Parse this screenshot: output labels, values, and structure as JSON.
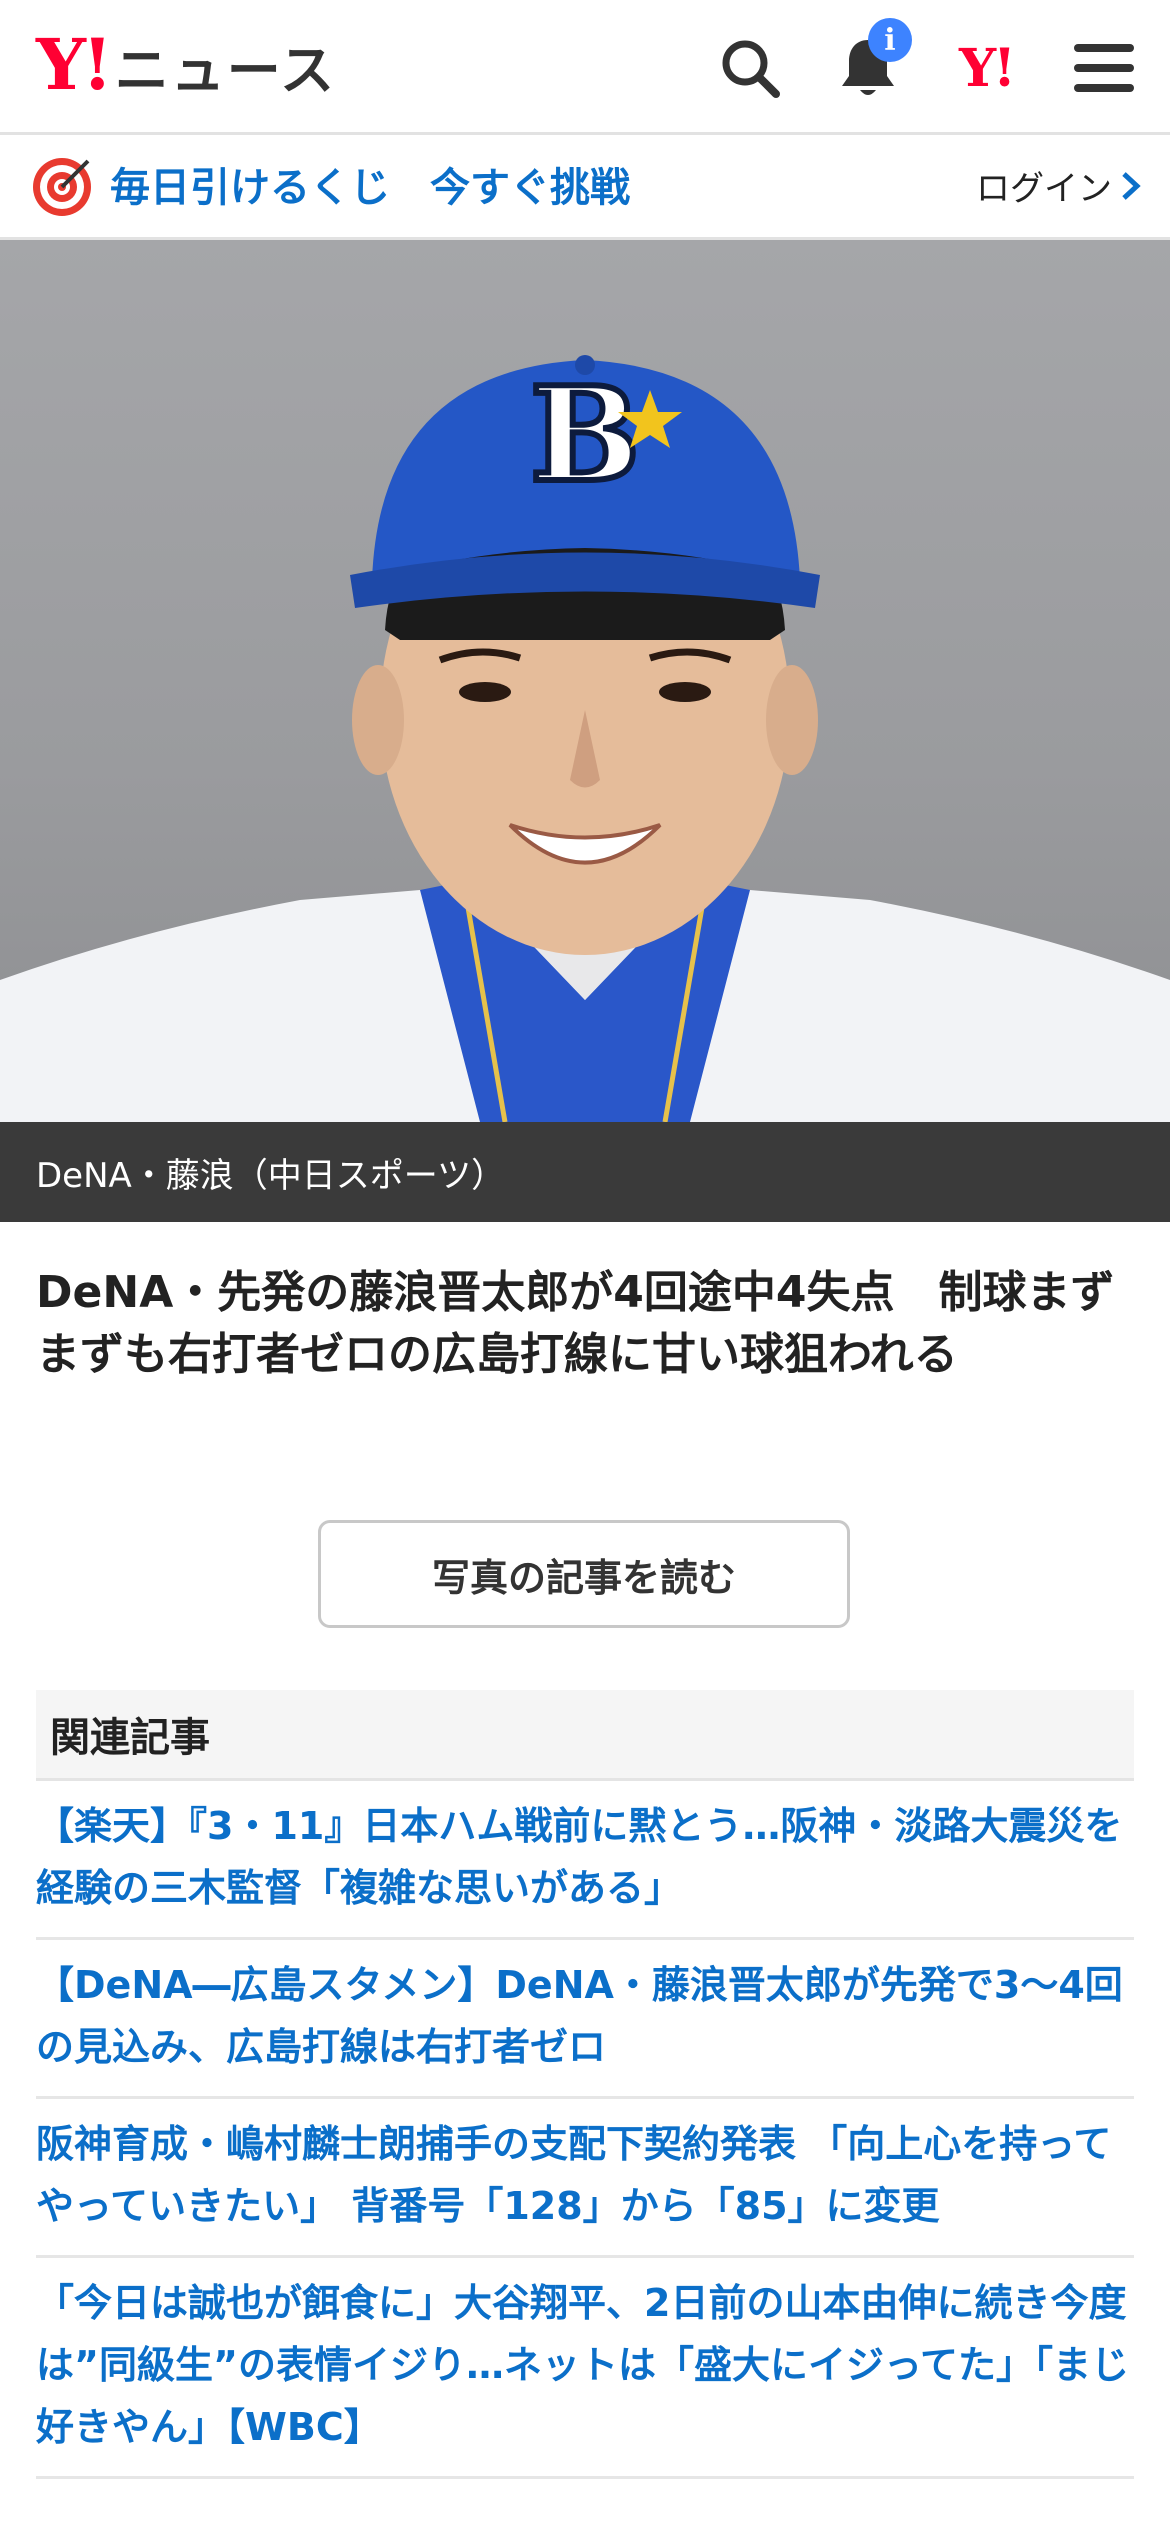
{
  "header": {
    "logo_y": "Y!",
    "logo_news": "ニュース",
    "notification_badge": "i",
    "yahoo_mark": "Y!"
  },
  "promo": {
    "text": "毎日引けるくじ　今すぐ挑戦",
    "login_label": "ログイン"
  },
  "photo": {
    "caption": "DeNA・藤浪（中日スポーツ）"
  },
  "article": {
    "title": "DeNA・先発の藤浪晋太郎が4回途中4失点　制球まずまずも右打者ゼロの広島打線に甘い球狙われる",
    "read_button": "写真の記事を読む"
  },
  "related": {
    "heading": "関連記事",
    "items": [
      "【楽天】『3・11』日本ハム戦前に黙とう…阪神・淡路大震災を経験の三木監督「複雑な思いがある」",
      "【DeNA―広島スタメン】DeNA・藤浪晋太郎が先発で3〜4回の見込み、広島打線は右打者ゼロ",
      "阪神育成・嶋村麟士朗捕手の支配下契約発表 「向上心を持ってやっていきたい」 背番号「128」から「85」に変更",
      "「今日は誠也が餌食に」大谷翔平、2日前の山本由伸に続き今度は”同級生”の表情イジり…ネットは「盛大にイジってた」「まじ好きやん」【WBC】"
    ]
  },
  "colors": {
    "brand_red": "#ff0033",
    "link_blue": "#0b6fc9",
    "badge_blue": "#3d83ff",
    "caption_bg": "#3a3a3a",
    "cap_blue": "#1f4fc4"
  }
}
